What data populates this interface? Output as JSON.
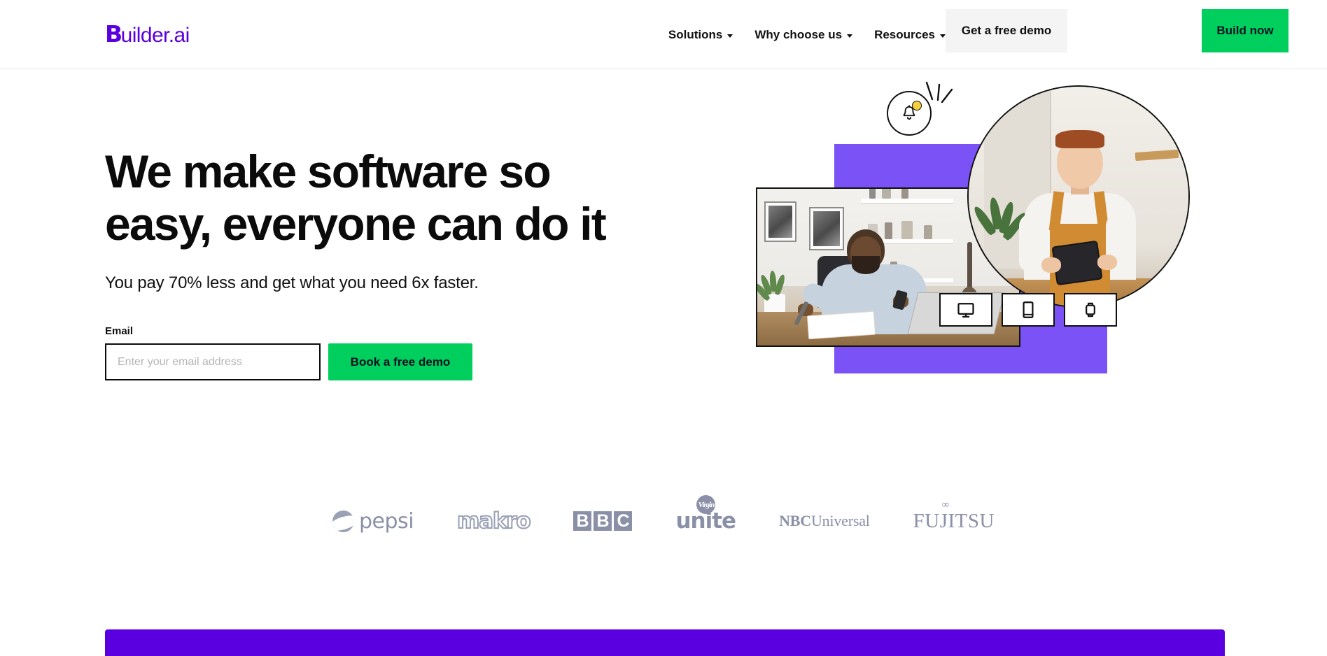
{
  "brand": {
    "logo_mark": "B",
    "logo_rest": "uilder.ai",
    "purple": "#5a00e0",
    "green": "#00cf5d",
    "hero_purple": "#7b52f5"
  },
  "header": {
    "nav": [
      {
        "label": "Solutions",
        "has_caret": true,
        "icon": "chevron-down-icon"
      },
      {
        "label": "Why choose us",
        "has_caret": true,
        "icon": "chevron-down-icon"
      },
      {
        "label": "Resources",
        "has_caret": true,
        "icon": "chevron-down-icon"
      }
    ],
    "demo_button": "Get a free demo",
    "build_button": "Build now"
  },
  "hero": {
    "headline_line1": "We make software so",
    "headline_line2": "easy, everyone can do it",
    "subhead": "You pay 70% less and get what you need 6x faster.",
    "form": {
      "label": "Email",
      "placeholder": "Enter your email address",
      "value": "",
      "submit": "Book a free demo"
    },
    "badge": {
      "icon": "bell-icon",
      "dot_color": "#f5cf3d"
    },
    "devices": [
      {
        "icon": "desktop-monitor-icon",
        "name": "desktop"
      },
      {
        "icon": "tablet-icon",
        "name": "tablet"
      },
      {
        "icon": "smartwatch-icon",
        "name": "smartwatch"
      }
    ]
  },
  "logos": {
    "items": [
      {
        "name": "pepsi",
        "text": "pepsi"
      },
      {
        "name": "makro",
        "text": "makro"
      },
      {
        "name": "bbc",
        "letters": [
          "B",
          "B",
          "C"
        ]
      },
      {
        "name": "virgin-unite",
        "text": "unite",
        "mark": "Virgin"
      },
      {
        "name": "nbcuniversal",
        "bold": "NBC",
        "rest": "Universal"
      },
      {
        "name": "fujitsu",
        "text": "FUJITSU",
        "mark": "∞"
      }
    ]
  }
}
